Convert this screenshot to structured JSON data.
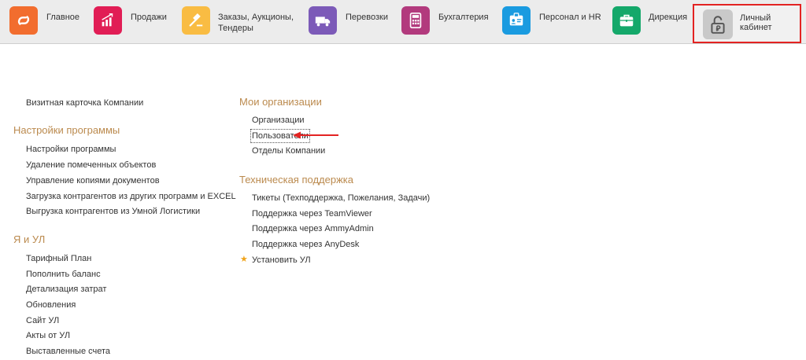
{
  "nav": {
    "items": [
      {
        "label": "Главное",
        "icon": "fan-logo-icon",
        "color": "#f26d2e"
      },
      {
        "label": "Продажи",
        "icon": "growth-chart-icon",
        "color": "#e11d55"
      },
      {
        "label": "Заказы,  Аукционы, Тендеры",
        "icon": "gavel-icon",
        "color": "#f9bc43"
      },
      {
        "label": "Перевозки",
        "icon": "truck-icon",
        "color": "#7c5ab8"
      },
      {
        "label": "Бухгалтерия",
        "icon": "calculator-icon",
        "color": "#b23a7d"
      },
      {
        "label": "Персонал и HR",
        "icon": "id-badge-icon",
        "color": "#1a9be0"
      },
      {
        "label": "Дирекция",
        "icon": "briefcase-icon",
        "color": "#14a86a"
      }
    ],
    "cabinet": {
      "label": "Личный кабинет",
      "icon": "unlock-ruble-icon",
      "color": "#c9c9c9",
      "highlight": "#e32322"
    }
  },
  "left": {
    "company_card": "Визитная карточка Компании",
    "settings": {
      "heading": "Настройки программы",
      "items": [
        "Настройки программы",
        "Удаление помеченных объектов",
        "Управление копиями документов",
        "Загрузка контрагентов из других программ и EXCEL",
        "Выгрузка контрагентов из Умной Логистики"
      ]
    },
    "ya": {
      "heading": "Я и УЛ",
      "items": [
        "Тарифный План",
        "Пополнить баланс",
        "Детализация затрат",
        "Обновления",
        "Сайт УЛ",
        "Акты от УЛ",
        "Выставленные счета"
      ]
    }
  },
  "right": {
    "orgs": {
      "heading": "Мои организации",
      "items": [
        "Организации",
        "Пользователи",
        "Отделы Компании"
      ]
    },
    "support": {
      "heading": "Техническая поддержка",
      "items": [
        "Тикеты (Техподдержка, Пожелания, Задачи)",
        "Поддержка через TeamViewer",
        "Поддержка через AmmyAdmin",
        "Поддержка через AnyDesk",
        "Установить УЛ"
      ]
    }
  },
  "accent_heading_color": "#bb8a4e",
  "annotation_color": "#e32322"
}
